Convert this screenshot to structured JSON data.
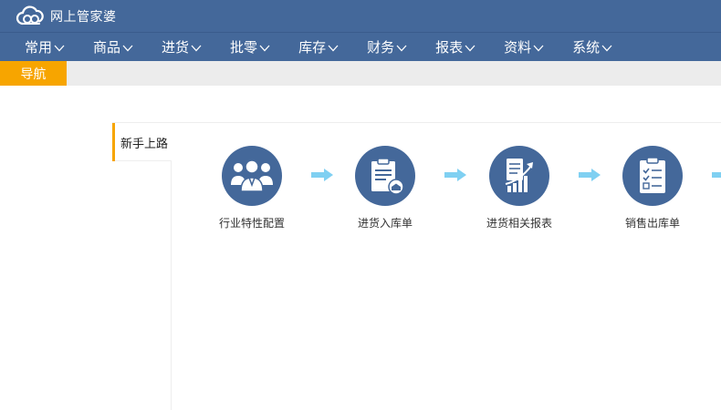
{
  "app": {
    "logo_text": "网上管家婆"
  },
  "menu": [
    {
      "label": "常用"
    },
    {
      "label": "商品"
    },
    {
      "label": "进货"
    },
    {
      "label": "批零"
    },
    {
      "label": "库存"
    },
    {
      "label": "财务"
    },
    {
      "label": "报表"
    },
    {
      "label": "资料"
    },
    {
      "label": "系统"
    }
  ],
  "tabs": {
    "active_label": "导航"
  },
  "panel": {
    "side_tab_label": "新手上路",
    "steps": [
      {
        "label": "行业特性配置",
        "icon": "team-icon"
      },
      {
        "label": "进货入库单",
        "icon": "warehouse-form-icon"
      },
      {
        "label": "进货相关报表",
        "icon": "report-chart-icon"
      },
      {
        "label": "销售出库单",
        "icon": "checklist-icon"
      }
    ]
  },
  "colors": {
    "primary": "#44689a",
    "accent": "#f7a500",
    "arrow": "#7fd0f2",
    "tabstrip": "#ececec"
  }
}
